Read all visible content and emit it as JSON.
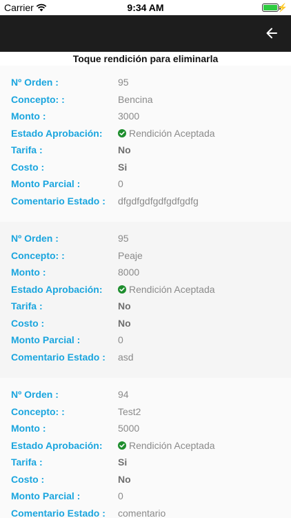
{
  "status_bar": {
    "carrier": "Carrier",
    "time": "9:34 AM",
    "battery_level": 1.0
  },
  "nav": {
    "back_icon": "arrow-left-icon"
  },
  "hint": "Toque rendición para eliminarla",
  "labels": {
    "orden": "Nº Orden :",
    "concepto": "Concepto: :",
    "monto": "Monto :",
    "estado": "Estado Aprobación:",
    "tarifa": "Tarifa :",
    "costo": "Costo :",
    "monto_parcial": "Monto Parcial :",
    "comentario": "Comentario Estado :"
  },
  "items": [
    {
      "orden": "95",
      "concepto": "Bencina",
      "monto": "3000",
      "estado": "Rendición Aceptada",
      "tarifa": "No",
      "costo": "Si",
      "monto_parcial": "0",
      "comentario": "dfgdfgdfgdfgdfgdfg"
    },
    {
      "orden": "95",
      "concepto": "Peaje",
      "monto": "8000",
      "estado": "Rendición Aceptada",
      "tarifa": "No",
      "costo": "No",
      "monto_parcial": "0",
      "comentario": "asd"
    },
    {
      "orden": "94",
      "concepto": "Test2",
      "monto": "5000",
      "estado": "Rendición Aceptada",
      "tarifa": "Si",
      "costo": "No",
      "monto_parcial": "0",
      "comentario": "comentario"
    }
  ],
  "colors": {
    "label": "#1aa5de",
    "value": "#8a8a8a",
    "accepted": "#1e8e2e",
    "navbar": "#1d1d1d"
  }
}
